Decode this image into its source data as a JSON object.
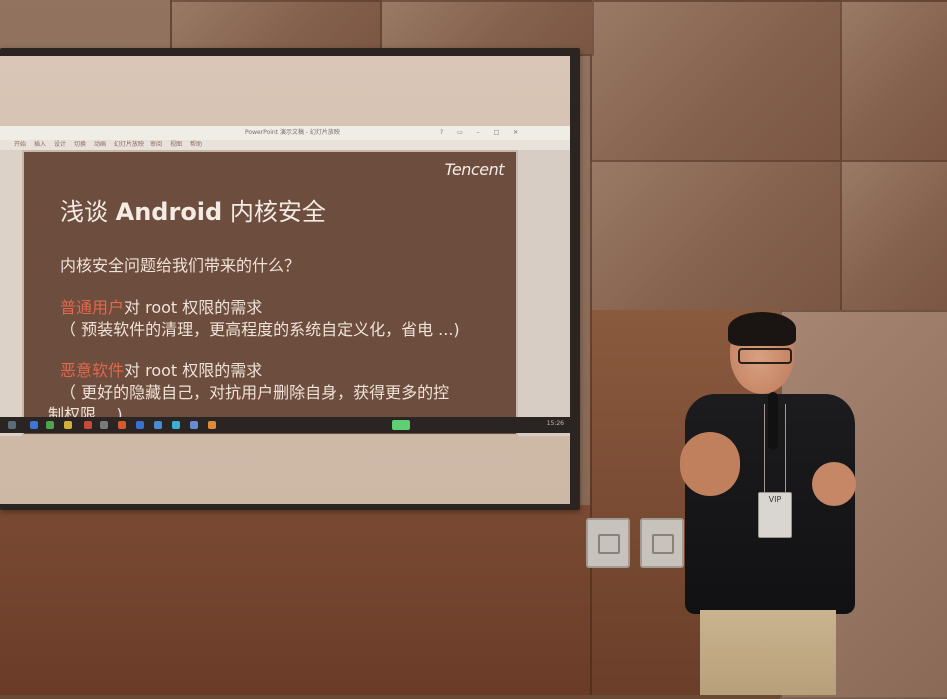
{
  "ppt": {
    "window_title": "PowerPoint 演示文稿 - 幻灯片放映",
    "ribbon_tabs": [
      "开始",
      "插入",
      "设计",
      "切换",
      "动画",
      "幻灯片放映",
      "审阅",
      "视图",
      "帮助"
    ],
    "clock": "15:26"
  },
  "slide": {
    "brand": "Tencent",
    "title_prefix": "浅谈 ",
    "title_bold": "Android",
    "title_suffix": " 内核安全",
    "question": "内核安全问题给我们带来的什么？",
    "p1_highlight": "普通用户",
    "p1_rest": "对 root 权限的需求",
    "p1_detail": "（ 预装软件的清理，更高程度的系统自定义化，省电 ...)",
    "p2_highlight": "恶意软件",
    "p2_rest": "对 root 权限的需求",
    "p2_detail_1": "（ 更好的隐藏自己，对抗用户删除自身，获得更多的控",
    "p2_detail_2": "制权限 ...)"
  },
  "speaker": {
    "badge": "VIP"
  },
  "colors": {
    "slide_bg": "#6d4d3d",
    "highlight": "#e2674d",
    "slide_text": "#efe2d8"
  }
}
